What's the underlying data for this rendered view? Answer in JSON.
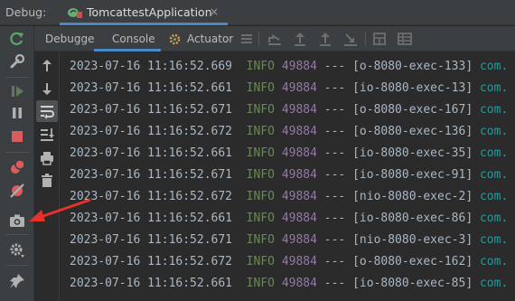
{
  "debug_bar": {
    "label": "Debug:",
    "tab_title": "TomcattestApplication",
    "close_glyph": "×"
  },
  "tabs": [
    {
      "label": "Debugger",
      "icon": "debugger-icon",
      "active": false
    },
    {
      "label": "Console",
      "icon": "console-icon",
      "active": true
    },
    {
      "label": "Actuator",
      "icon": "actuator-icon",
      "active": false
    }
  ],
  "toolbar_icons": [
    "menu-icon",
    "show-execution-point-icon",
    "step-over-icon",
    "step-into-icon",
    "step-out-icon",
    "force-step-into-icon",
    "evaluate-icon",
    "table-icon"
  ],
  "side_icons": [
    "rerun-icon",
    "wrench-icon",
    "resume-icon",
    "pause-icon",
    "stop-icon",
    "view-breakpoints-icon",
    "mute-breakpoints-icon",
    "camera-icon",
    "settings-icon",
    "pin-icon"
  ],
  "console_icons": [
    "up-arrow-icon",
    "down-arrow-icon",
    "soft-wrap-icon",
    "scroll-to-end-icon",
    "print-icon",
    "trash-icon"
  ],
  "colors": {
    "timestamp": "#a9b7c6",
    "level": "#6a8759",
    "pid": "#9876aa",
    "class": "#299999",
    "accent": "#4a88c7",
    "arrow": "#e8312a"
  },
  "log_lines": [
    {
      "timestamp": "2023-07-16 11:16:52.669",
      "level": "INFO",
      "pid": "49884",
      "sep": "---",
      "thread": "[o-8080-exec-133]",
      "cls": "com."
    },
    {
      "timestamp": "2023-07-16 11:16:52.661",
      "level": "INFO",
      "pid": "49884",
      "sep": "---",
      "thread": "[io-8080-exec-13]",
      "cls": "com."
    },
    {
      "timestamp": "2023-07-16 11:16:52.671",
      "level": "INFO",
      "pid": "49884",
      "sep": "---",
      "thread": "[o-8080-exec-167]",
      "cls": "com."
    },
    {
      "timestamp": "2023-07-16 11:16:52.672",
      "level": "INFO",
      "pid": "49884",
      "sep": "---",
      "thread": "[o-8080-exec-136]",
      "cls": "com."
    },
    {
      "timestamp": "2023-07-16 11:16:52.661",
      "level": "INFO",
      "pid": "49884",
      "sep": "---",
      "thread": "[io-8080-exec-35]",
      "cls": "com."
    },
    {
      "timestamp": "2023-07-16 11:16:52.671",
      "level": "INFO",
      "pid": "49884",
      "sep": "---",
      "thread": "[io-8080-exec-91]",
      "cls": "com."
    },
    {
      "timestamp": "2023-07-16 11:16:52.672",
      "level": "INFO",
      "pid": "49884",
      "sep": "---",
      "thread": "[nio-8080-exec-2]",
      "cls": "com."
    },
    {
      "timestamp": "2023-07-16 11:16:52.661",
      "level": "INFO",
      "pid": "49884",
      "sep": "---",
      "thread": "[io-8080-exec-86]",
      "cls": "com."
    },
    {
      "timestamp": "2023-07-16 11:16:52.671",
      "level": "INFO",
      "pid": "49884",
      "sep": "---",
      "thread": "[nio-8080-exec-3]",
      "cls": "com."
    },
    {
      "timestamp": "2023-07-16 11:16:52.672",
      "level": "INFO",
      "pid": "49884",
      "sep": "---",
      "thread": "[o-8080-exec-162]",
      "cls": "com."
    },
    {
      "timestamp": "2023-07-16 11:16:52.661",
      "level": "INFO",
      "pid": "49884",
      "sep": "---",
      "thread": "[io-8080-exec-85]",
      "cls": "com."
    }
  ]
}
